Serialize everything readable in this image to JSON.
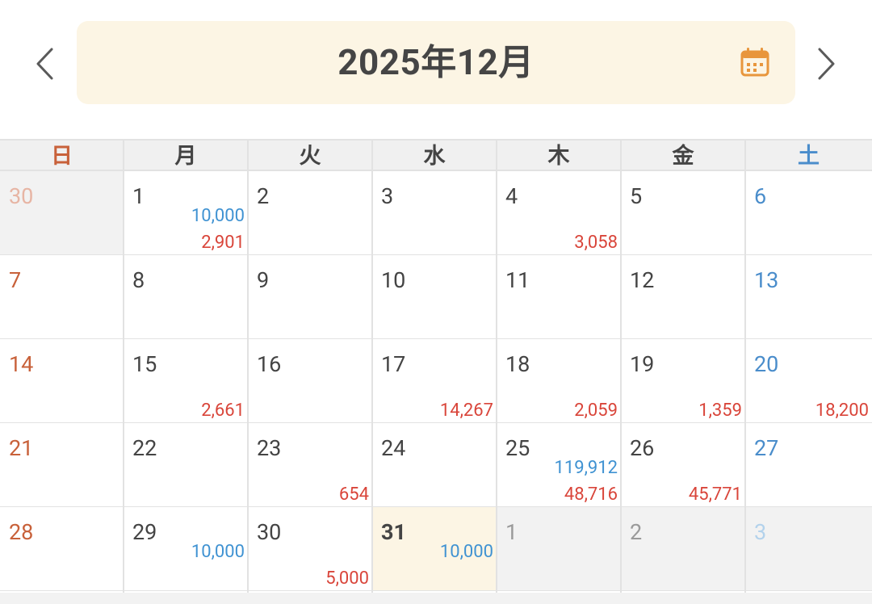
{
  "header": {
    "title": "2025年12月",
    "prev_icon": "chevron-left-icon",
    "next_icon": "chevron-right-icon",
    "calendar_icon": "calendar-icon",
    "calendar_icon_color": "#e8963c"
  },
  "weekdays": [
    "日",
    "月",
    "火",
    "水",
    "木",
    "金",
    "土"
  ],
  "colors": {
    "sunday": "#c8613a",
    "saturday": "#4a8dcb",
    "income": "#3f92d2",
    "expense": "#d9453a",
    "today_bg": "#fcf5e4",
    "other_month_bg": "#f2f2f2"
  },
  "weeks": [
    [
      {
        "day": "30",
        "other": true
      },
      {
        "day": "1",
        "income": "10,000",
        "expense": "2,901"
      },
      {
        "day": "2"
      },
      {
        "day": "3"
      },
      {
        "day": "4",
        "expense": "3,058"
      },
      {
        "day": "5"
      },
      {
        "day": "6"
      }
    ],
    [
      {
        "day": "7"
      },
      {
        "day": "8"
      },
      {
        "day": "9"
      },
      {
        "day": "10"
      },
      {
        "day": "11"
      },
      {
        "day": "12"
      },
      {
        "day": "13"
      }
    ],
    [
      {
        "day": "14"
      },
      {
        "day": "15",
        "expense": "2,661"
      },
      {
        "day": "16"
      },
      {
        "day": "17",
        "expense": "14,267"
      },
      {
        "day": "18",
        "expense": "2,059"
      },
      {
        "day": "19",
        "expense": "1,359"
      },
      {
        "day": "20",
        "expense": "18,200"
      }
    ],
    [
      {
        "day": "21"
      },
      {
        "day": "22"
      },
      {
        "day": "23",
        "expense": "654"
      },
      {
        "day": "24"
      },
      {
        "day": "25",
        "income": "119,912",
        "expense": "48,716"
      },
      {
        "day": "26",
        "expense": "45,771"
      },
      {
        "day": "27"
      }
    ],
    [
      {
        "day": "28"
      },
      {
        "day": "29",
        "income": "10,000"
      },
      {
        "day": "30",
        "expense": "5,000"
      },
      {
        "day": "31",
        "income": "10,000",
        "today": true
      },
      {
        "day": "1",
        "other": true
      },
      {
        "day": "2",
        "other": true
      },
      {
        "day": "3",
        "other": true
      }
    ]
  ]
}
